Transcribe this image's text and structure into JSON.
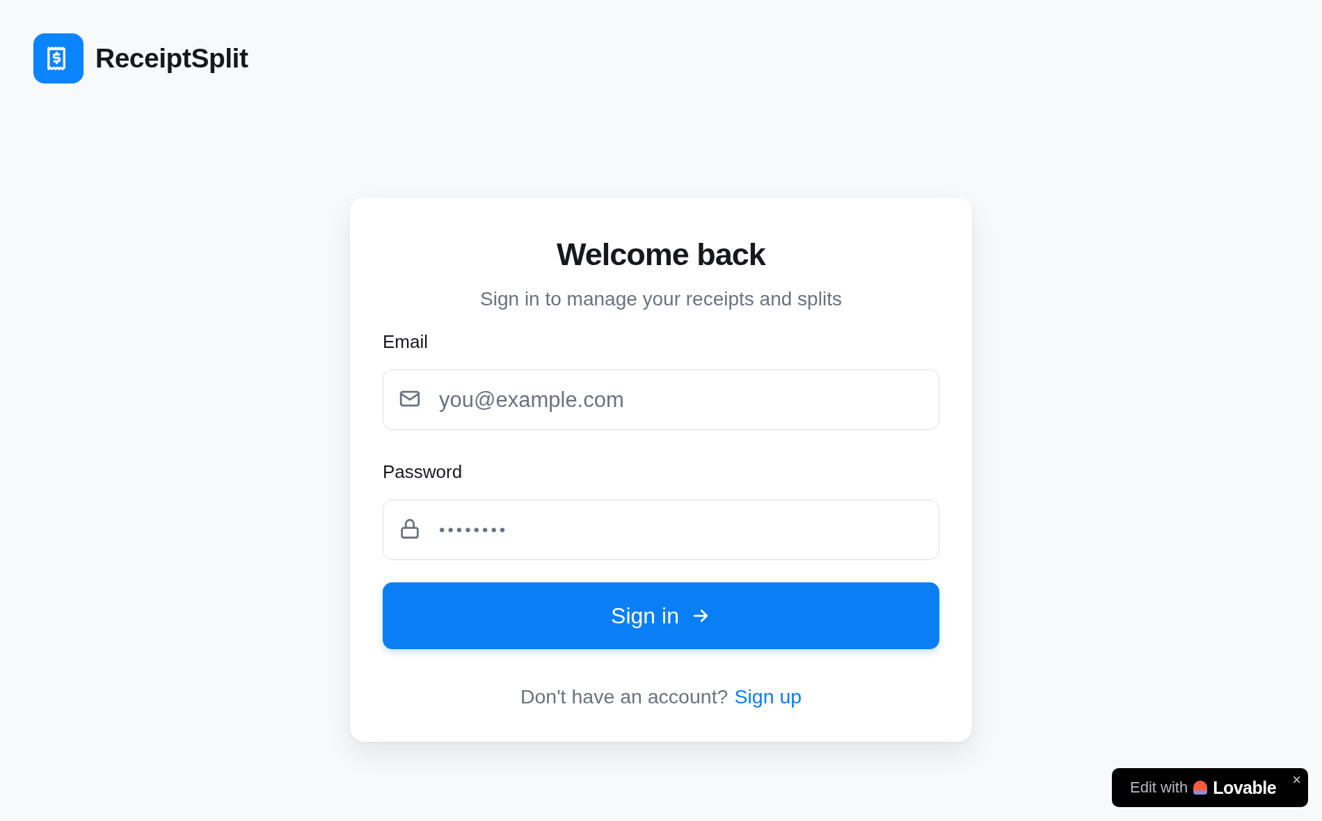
{
  "brand": {
    "name": "ReceiptSplit"
  },
  "card": {
    "title": "Welcome back",
    "subtitle": "Sign in to manage your receipts and splits",
    "fields": [
      {
        "kind": "email",
        "label": "Email",
        "placeholder": "you@example.com"
      },
      {
        "kind": "password",
        "label": "Password",
        "placeholder": "••••••••"
      }
    ],
    "submit": {
      "label": "Sign in"
    },
    "footer": {
      "text": "Don't have an account?",
      "link": "Sign up"
    }
  },
  "edit_badge": {
    "prefix": "Edit with",
    "brand": "Lovable",
    "close": "×"
  }
}
